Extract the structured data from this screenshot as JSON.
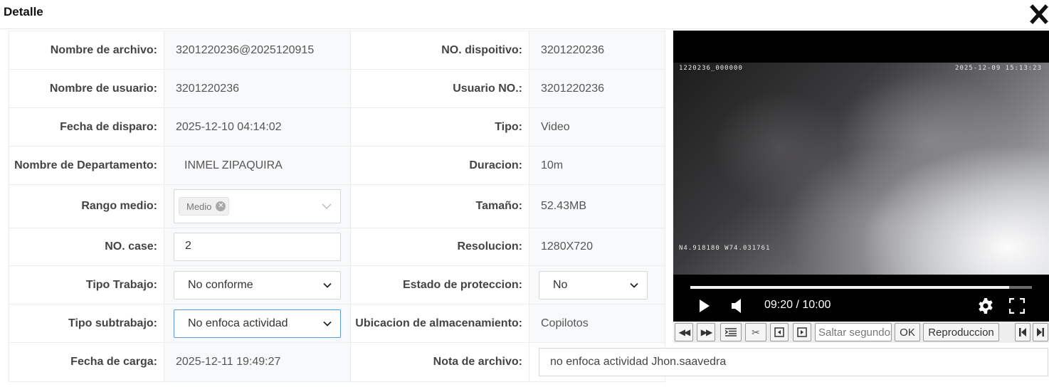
{
  "dialog": {
    "title": "Detalle"
  },
  "fields": {
    "file_name": {
      "label": "Nombre de archivo:",
      "value": "3201220236@2025120915"
    },
    "device_no": {
      "label": "NO. dispoitivo:",
      "value": "3201220236"
    },
    "user_name": {
      "label": "Nombre de usuario:",
      "value": "3201220236"
    },
    "user_no": {
      "label": "Usuario NO.:",
      "value": "3201220236"
    },
    "trigger_date": {
      "label": "Fecha de disparo:",
      "value": "2025-12-10 04:14:02"
    },
    "type": {
      "label": "Tipo:",
      "value": "Video"
    },
    "department": {
      "label": "Nombre de Departamento:",
      "value": "INMEL ZIPAQUIRA"
    },
    "duration": {
      "label": "Duracion:",
      "value": "10m"
    },
    "range": {
      "label": "Rango medio:",
      "tag": "Medio"
    },
    "size": {
      "label": "Tamaño:",
      "value": "52.43MB"
    },
    "case_no": {
      "label": "NO. case:",
      "value": "2"
    },
    "resolution": {
      "label": "Resolucion:",
      "value": "1280X720"
    },
    "work_type": {
      "label": "Tipo Trabajo:",
      "value": "No conforme"
    },
    "protection": {
      "label": "Estado de proteccion:",
      "value": "No"
    },
    "subwork_type": {
      "label": "Tipo subtrabajo:",
      "value": "No enfoca actividad"
    },
    "storage": {
      "label": "Ubicacion de almacenamiento:",
      "value": "Copilotos"
    },
    "upload_date": {
      "label": "Fecha de carga:",
      "value": "2025-12-11 19:49:27"
    },
    "note": {
      "label": "Nota de archivo:",
      "value": "no enfoca actividad Jhon.saavedra"
    }
  },
  "player": {
    "overlay_top_left": "1220236_000000",
    "overlay_top_right": "2025-12-09 15:13:23",
    "overlay_bottom_left": "N4.918180 W74.031761",
    "timecode": "09:20 / 10:00",
    "progress": 0.933
  },
  "toolbar": {
    "seek_placeholder": "Saltar segundos",
    "ok_label": "OK",
    "playback_label": "Reproduccion"
  },
  "icons": [
    "close-icon",
    "chevron-down-icon",
    "tag-remove-icon",
    "play-icon",
    "volume-icon",
    "settings-icon",
    "fullscreen-icon",
    "rewind-icon",
    "fast-forward-icon",
    "list-icon",
    "scissors-icon",
    "prev-frame-icon",
    "next-frame-icon",
    "skip-start-icon",
    "skip-end-icon"
  ]
}
